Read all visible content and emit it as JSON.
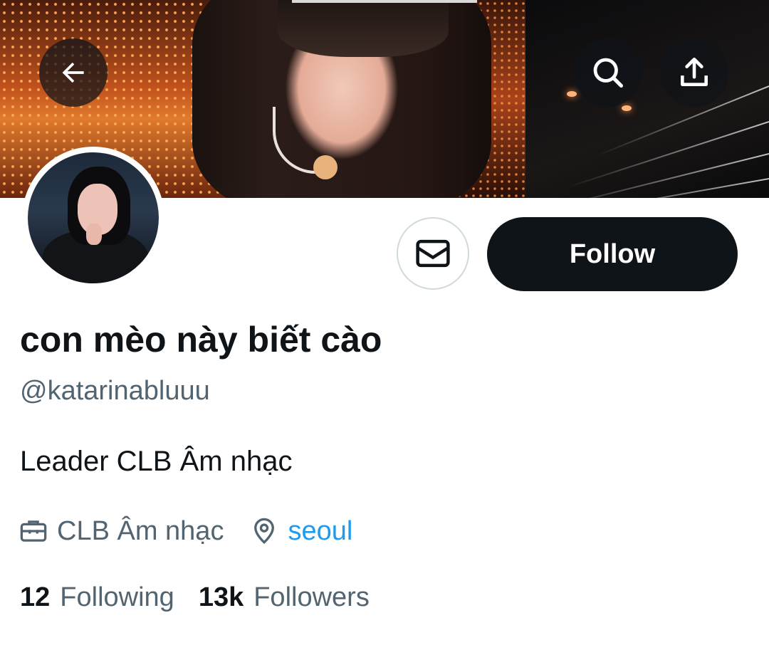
{
  "header": {
    "back_icon": "arrow-left-icon",
    "search_icon": "search-icon",
    "share_icon": "share-upload-icon"
  },
  "profile": {
    "display_name": "con mèo này biết cào",
    "handle": "@katarinabluuu",
    "bio": "Leader CLB Âm nhạc",
    "work": "CLB Âm nhạc",
    "location": "seoul"
  },
  "actions": {
    "message_icon": "envelope-icon",
    "follow_label": "Follow"
  },
  "stats": {
    "following_count": "12",
    "following_label": "Following",
    "followers_count": "13k",
    "followers_label": "Followers"
  },
  "colors": {
    "text_primary": "#0f1419",
    "text_secondary": "#536471",
    "link": "#1d9bf0",
    "follow_bg": "#0f1419"
  }
}
